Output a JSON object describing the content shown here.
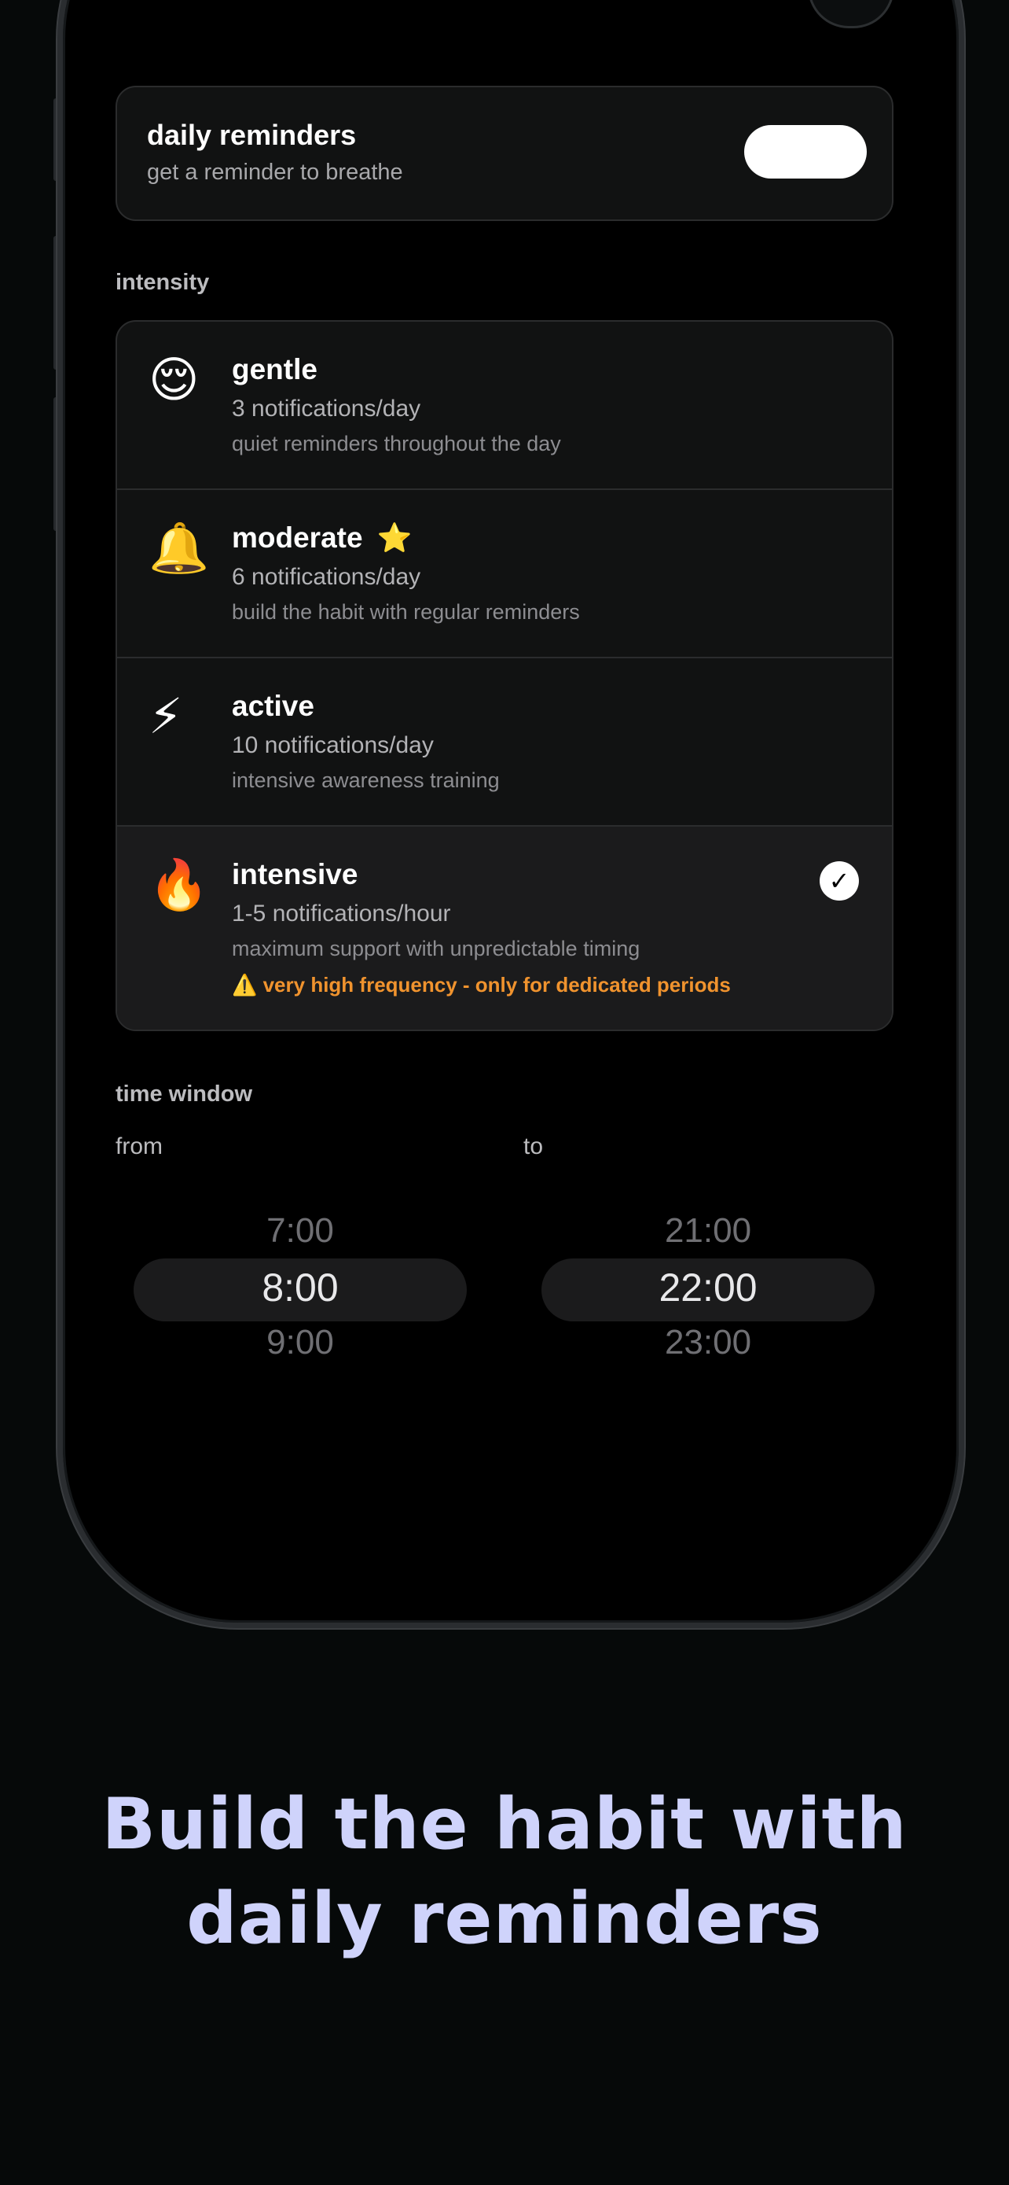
{
  "reminders": {
    "title": "daily reminders",
    "subtitle": "get a reminder to breathe",
    "enabled": true
  },
  "intensity": {
    "label": "intensity",
    "options": [
      {
        "emoji": "😌",
        "name": "gentle",
        "frequency": "3 notifications/day",
        "description": "quiet reminders throughout the day"
      },
      {
        "emoji": "🔔",
        "name": "moderate",
        "badge": "⭐",
        "frequency": "6 notifications/day",
        "description": "build the habit with regular reminders"
      },
      {
        "emoji": "⚡",
        "name": "active",
        "frequency": "10 notifications/day",
        "description": "intensive awareness training"
      },
      {
        "emoji": "🔥",
        "name": "intensive",
        "frequency": "1-5 notifications/hour",
        "description": "maximum support with unpredictable timing",
        "warning": "⚠️ very high frequency - only for dedicated periods",
        "selected": true,
        "check": "✓"
      }
    ]
  },
  "time_window": {
    "label": "time window",
    "from": {
      "label": "from",
      "prev": "7:00",
      "current": "8:00",
      "next": "9:00"
    },
    "to": {
      "label": "to",
      "prev": "21:00",
      "current": "22:00",
      "next": "23:00"
    }
  },
  "headline": {
    "line1": "Build the habit with",
    "line2": "daily reminders"
  },
  "colors": {
    "background": "#060909",
    "headline": "#cfd3fb",
    "warning": "#f0932e",
    "card": "#111212"
  }
}
